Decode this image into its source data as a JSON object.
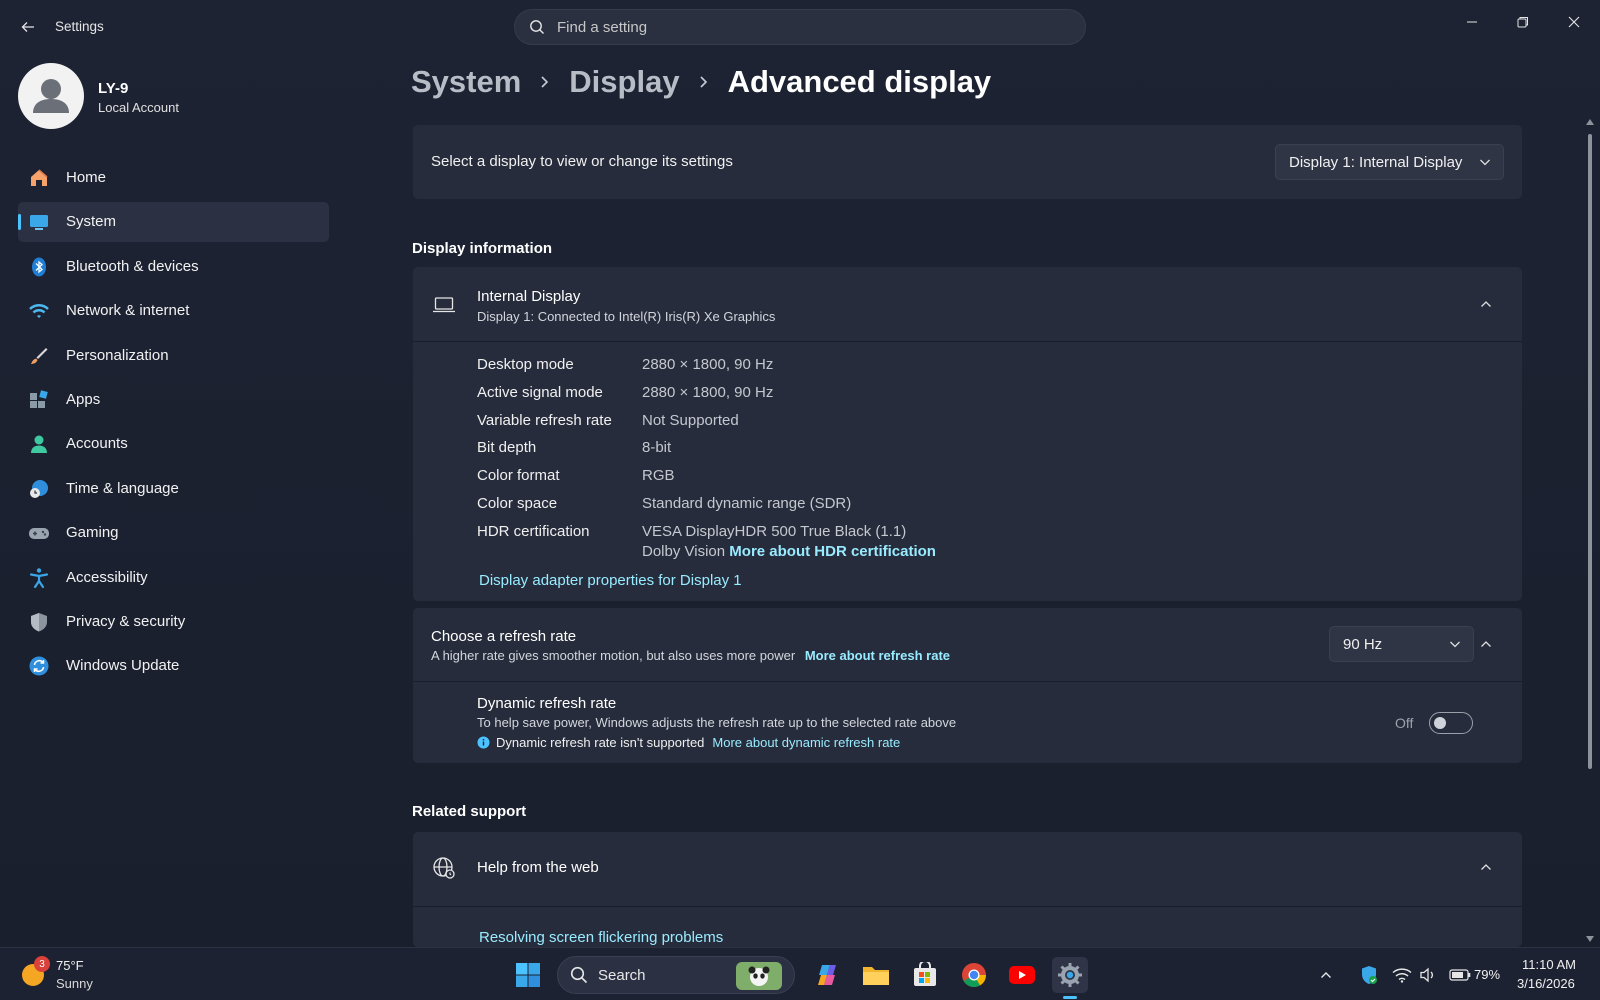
{
  "window": {
    "app_title": "Settings",
    "search_placeholder": "Find a setting"
  },
  "profile": {
    "name": "LY-9",
    "account_type": "Local Account"
  },
  "sidebar": {
    "items": [
      {
        "label": "Home",
        "icon": "home-icon"
      },
      {
        "label": "System",
        "icon": "system-icon",
        "active": true
      },
      {
        "label": "Bluetooth & devices",
        "icon": "bluetooth-icon"
      },
      {
        "label": "Network & internet",
        "icon": "wifi-icon"
      },
      {
        "label": "Personalization",
        "icon": "brush-icon"
      },
      {
        "label": "Apps",
        "icon": "apps-icon"
      },
      {
        "label": "Accounts",
        "icon": "accounts-icon"
      },
      {
        "label": "Time & language",
        "icon": "globe-clock-icon"
      },
      {
        "label": "Gaming",
        "icon": "gamepad-icon"
      },
      {
        "label": "Accessibility",
        "icon": "accessibility-icon"
      },
      {
        "label": "Privacy & security",
        "icon": "shield-icon"
      },
      {
        "label": "Windows Update",
        "icon": "update-icon"
      }
    ]
  },
  "breadcrumb": {
    "items": [
      "System",
      "Display",
      "Advanced display"
    ]
  },
  "select_display": {
    "label": "Select a display to view or change its settings",
    "selected": "Display 1: Internal Display"
  },
  "display_info": {
    "section_title": "Display information",
    "display_name": "Internal Display",
    "display_sub": "Display 1: Connected to Intel(R) Iris(R) Xe Graphics",
    "rows": [
      {
        "key": "Desktop mode",
        "value": "2880 × 1800, 90 Hz"
      },
      {
        "key": "Active signal mode",
        "value": "2880 × 1800, 90 Hz"
      },
      {
        "key": "Variable refresh rate",
        "value": "Not Supported"
      },
      {
        "key": "Bit depth",
        "value": "8-bit"
      },
      {
        "key": "Color format",
        "value": "RGB"
      },
      {
        "key": "Color space",
        "value": "Standard dynamic range (SDR)"
      },
      {
        "key": "HDR certification",
        "value": "VESA DisplayHDR 500 True Black (1.1)"
      }
    ],
    "hdr_extra": "Dolby Vision",
    "hdr_link": "More about HDR certification",
    "adapter_link": "Display adapter properties for Display 1"
  },
  "refresh": {
    "title": "Choose a refresh rate",
    "sub": "A higher rate gives smoother motion, but also uses more power",
    "link": "More about refresh rate",
    "selected": "90 Hz",
    "dynamic_title": "Dynamic refresh rate",
    "dynamic_sub": "To help save power, Windows adjusts the refresh rate up to the selected rate above",
    "dynamic_note": "Dynamic refresh rate isn't supported",
    "dynamic_link": "More about dynamic refresh rate",
    "toggle_state": "Off"
  },
  "related": {
    "section_title": "Related support",
    "help_title": "Help from the web",
    "help_link": "Resolving screen flickering problems"
  },
  "taskbar": {
    "weather_temp": "75°F",
    "weather_cond": "Sunny",
    "weather_badge": "3",
    "search_label": "Search",
    "battery": "79%",
    "time": "11:10 AM",
    "date": "3/16/2026"
  },
  "colors": {
    "accent": "#4cc2ff",
    "link": "#99ebff",
    "card": "#262c3b"
  }
}
